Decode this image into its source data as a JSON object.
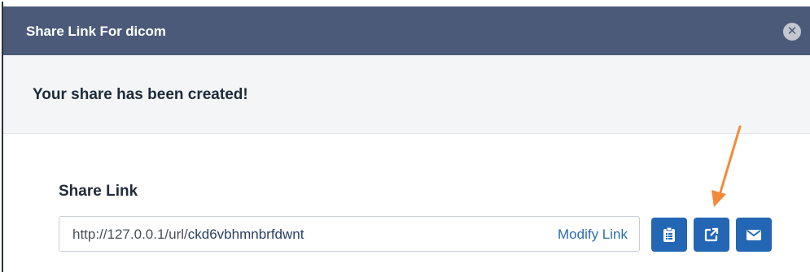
{
  "dialog": {
    "title": "Share Link For dicom",
    "close_icon": "close-icon"
  },
  "notice": {
    "text": "Your share has been created!"
  },
  "share_link": {
    "label": "Share Link",
    "url_prefix": "http://127.0.0.1/url/",
    "url_slug": "ckd6vbhmnbrfdwnt",
    "modify_label": "Modify Link"
  },
  "actions": {
    "copy_icon": "clipboard-icon",
    "open_icon": "external-link-icon",
    "email_icon": "envelope-icon"
  },
  "annotation": {
    "arrow_color": "#f28a3a"
  },
  "colors": {
    "header": "#4c5a79",
    "button": "#2366b4",
    "link": "#2b6cb0"
  }
}
